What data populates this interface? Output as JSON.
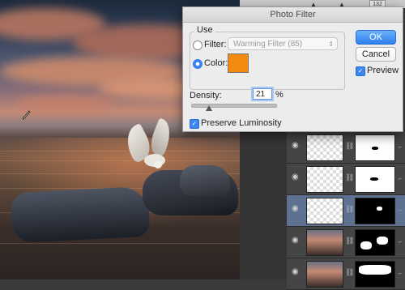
{
  "dialog": {
    "title": "Photo Filter",
    "use_label": "Use",
    "filter_label": "Filter:",
    "filter_value": "Warming Filter (85)",
    "color_label": "Color:",
    "color_value": "#f28a12",
    "selected_mode": "color",
    "density_label": "Density:",
    "density_value": "21",
    "density_unit": "%",
    "density_fraction": 0.21,
    "preserve_luminosity_label": "Preserve Luminosity",
    "preserve_luminosity_checked": true,
    "ok_label": "OK",
    "cancel_label": "Cancel",
    "preview_label": "Preview",
    "preview_checked": true
  },
  "ruler": {
    "value": "132"
  },
  "layers": [
    {
      "type": "transparent",
      "mask": "white",
      "selected": false
    },
    {
      "type": "transparent",
      "mask": "white",
      "selected": false
    },
    {
      "type": "transparent",
      "mask": "black",
      "selected": true
    },
    {
      "type": "photo",
      "mask": "black",
      "selected": false
    },
    {
      "type": "photo",
      "mask": "black",
      "selected": false
    }
  ],
  "icons": {
    "eye": "eye-icon",
    "link": "link-icon",
    "cursor": "eyedropper-icon",
    "checkmark": "checkmark-icon",
    "dropdown": "chevron-updown-icon"
  },
  "colors": {
    "accent": "#3b86f0",
    "selected_layer": "#5f7190"
  }
}
